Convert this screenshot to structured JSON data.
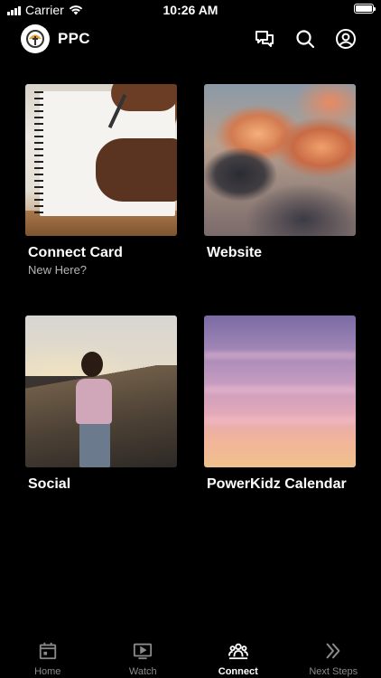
{
  "status_bar": {
    "carrier": "Carrier",
    "time": "10:26 AM"
  },
  "header": {
    "title": "PPC"
  },
  "cards": [
    {
      "title": "Connect Card",
      "subtitle": "New Here?"
    },
    {
      "title": "Website"
    },
    {
      "title": "Social"
    },
    {
      "title": "PowerKidz Calendar"
    }
  ],
  "tabs": [
    {
      "label": "Home",
      "icon": "calendar-icon",
      "active": false
    },
    {
      "label": "Watch",
      "icon": "play-icon",
      "active": false
    },
    {
      "label": "Connect",
      "icon": "group-icon",
      "active": true
    },
    {
      "label": "Next Steps",
      "icon": "chevrons-right-icon",
      "active": false
    }
  ],
  "colors": {
    "background": "#000000",
    "active_tab": "#ffffff",
    "inactive_tab": "#8a8a8a",
    "subtitle": "#b5b5b5"
  }
}
